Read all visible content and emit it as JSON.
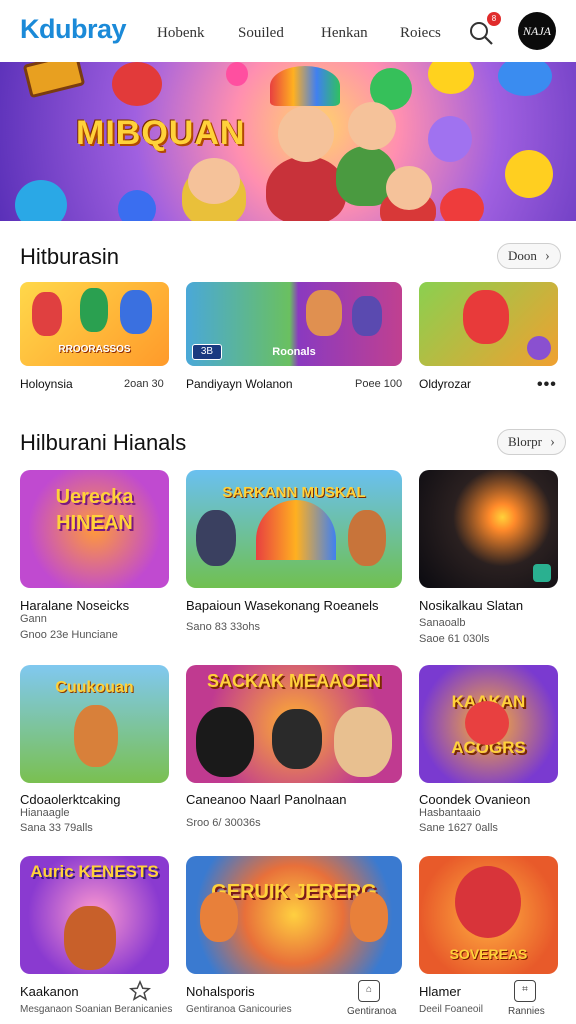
{
  "header": {
    "logo": "Kdubray",
    "nav": [
      "Hobenk",
      "Souiled",
      "Henkan",
      "Roiecs"
    ],
    "notification_count": "8",
    "avatar_text": "NAJA"
  },
  "hero": {
    "title": "MIBQUAN"
  },
  "section1": {
    "title": "Hitburasin",
    "more_label": "Doon",
    "items": [
      {
        "label": "Holoynsia",
        "meta": "2oan 30",
        "art": "RROORASSOS"
      },
      {
        "label": "Pandiyayn Wolanon",
        "meta": "Poee 100",
        "art": "Roonals"
      },
      {
        "label": "Oldyrozar",
        "meta": "",
        "art": ""
      }
    ]
  },
  "section2": {
    "title": "Hilburani Hianals",
    "more_label": "Blorpr",
    "cards": [
      {
        "art": "Uerecka HINEAN",
        "title": "Haralane Noseicks",
        "sub": "Gann",
        "meta": "Gnoo 23e Hunciane"
      },
      {
        "art": "SARKANN MUSKAL",
        "title": "Bapaioun Wasekonang Roeanels",
        "sub": "",
        "meta": "Sano 83 33ohs"
      },
      {
        "art": "",
        "title": "Nosikalkau Slatan",
        "sub": "Sanaoalb",
        "meta": "Saoe 61 030ls"
      },
      {
        "art": "Cuukouan",
        "title": "Cdoaolerktcaking",
        "sub": "Hianaagle",
        "meta": "Sana 33 79alls"
      },
      {
        "art": "SACKAK MEAAOEN",
        "title": "Caneanoo Naarl Panolnaan",
        "sub": "",
        "meta": "Sroo 6/ 30036s"
      },
      {
        "art": "KAAKAN ACOGRS",
        "title": "Coondek Ovanieon",
        "sub": "Hasbantaaio",
        "meta": "Sane 1627 0alls"
      },
      {
        "art": "Auric KENESTS",
        "title": "Kaakanon",
        "sub": "Mesganaon Soanian Beranicanies",
        "meta": ""
      },
      {
        "art": "GERUIK JERERG",
        "title": "Nohalsporis",
        "sub": "Gentiranoa Ganicouries",
        "meta": ""
      },
      {
        "art": "SOVEREAS",
        "title": "Hlamer",
        "sub": "Deeil Foaneoil",
        "meta": ""
      }
    ]
  },
  "bottom_nav": [
    {
      "icon": "star-icon",
      "label": ""
    },
    {
      "icon": "home-icon",
      "label": "Gentiranoa"
    },
    {
      "icon": "bookmark-icon",
      "label": "Rannies"
    }
  ]
}
